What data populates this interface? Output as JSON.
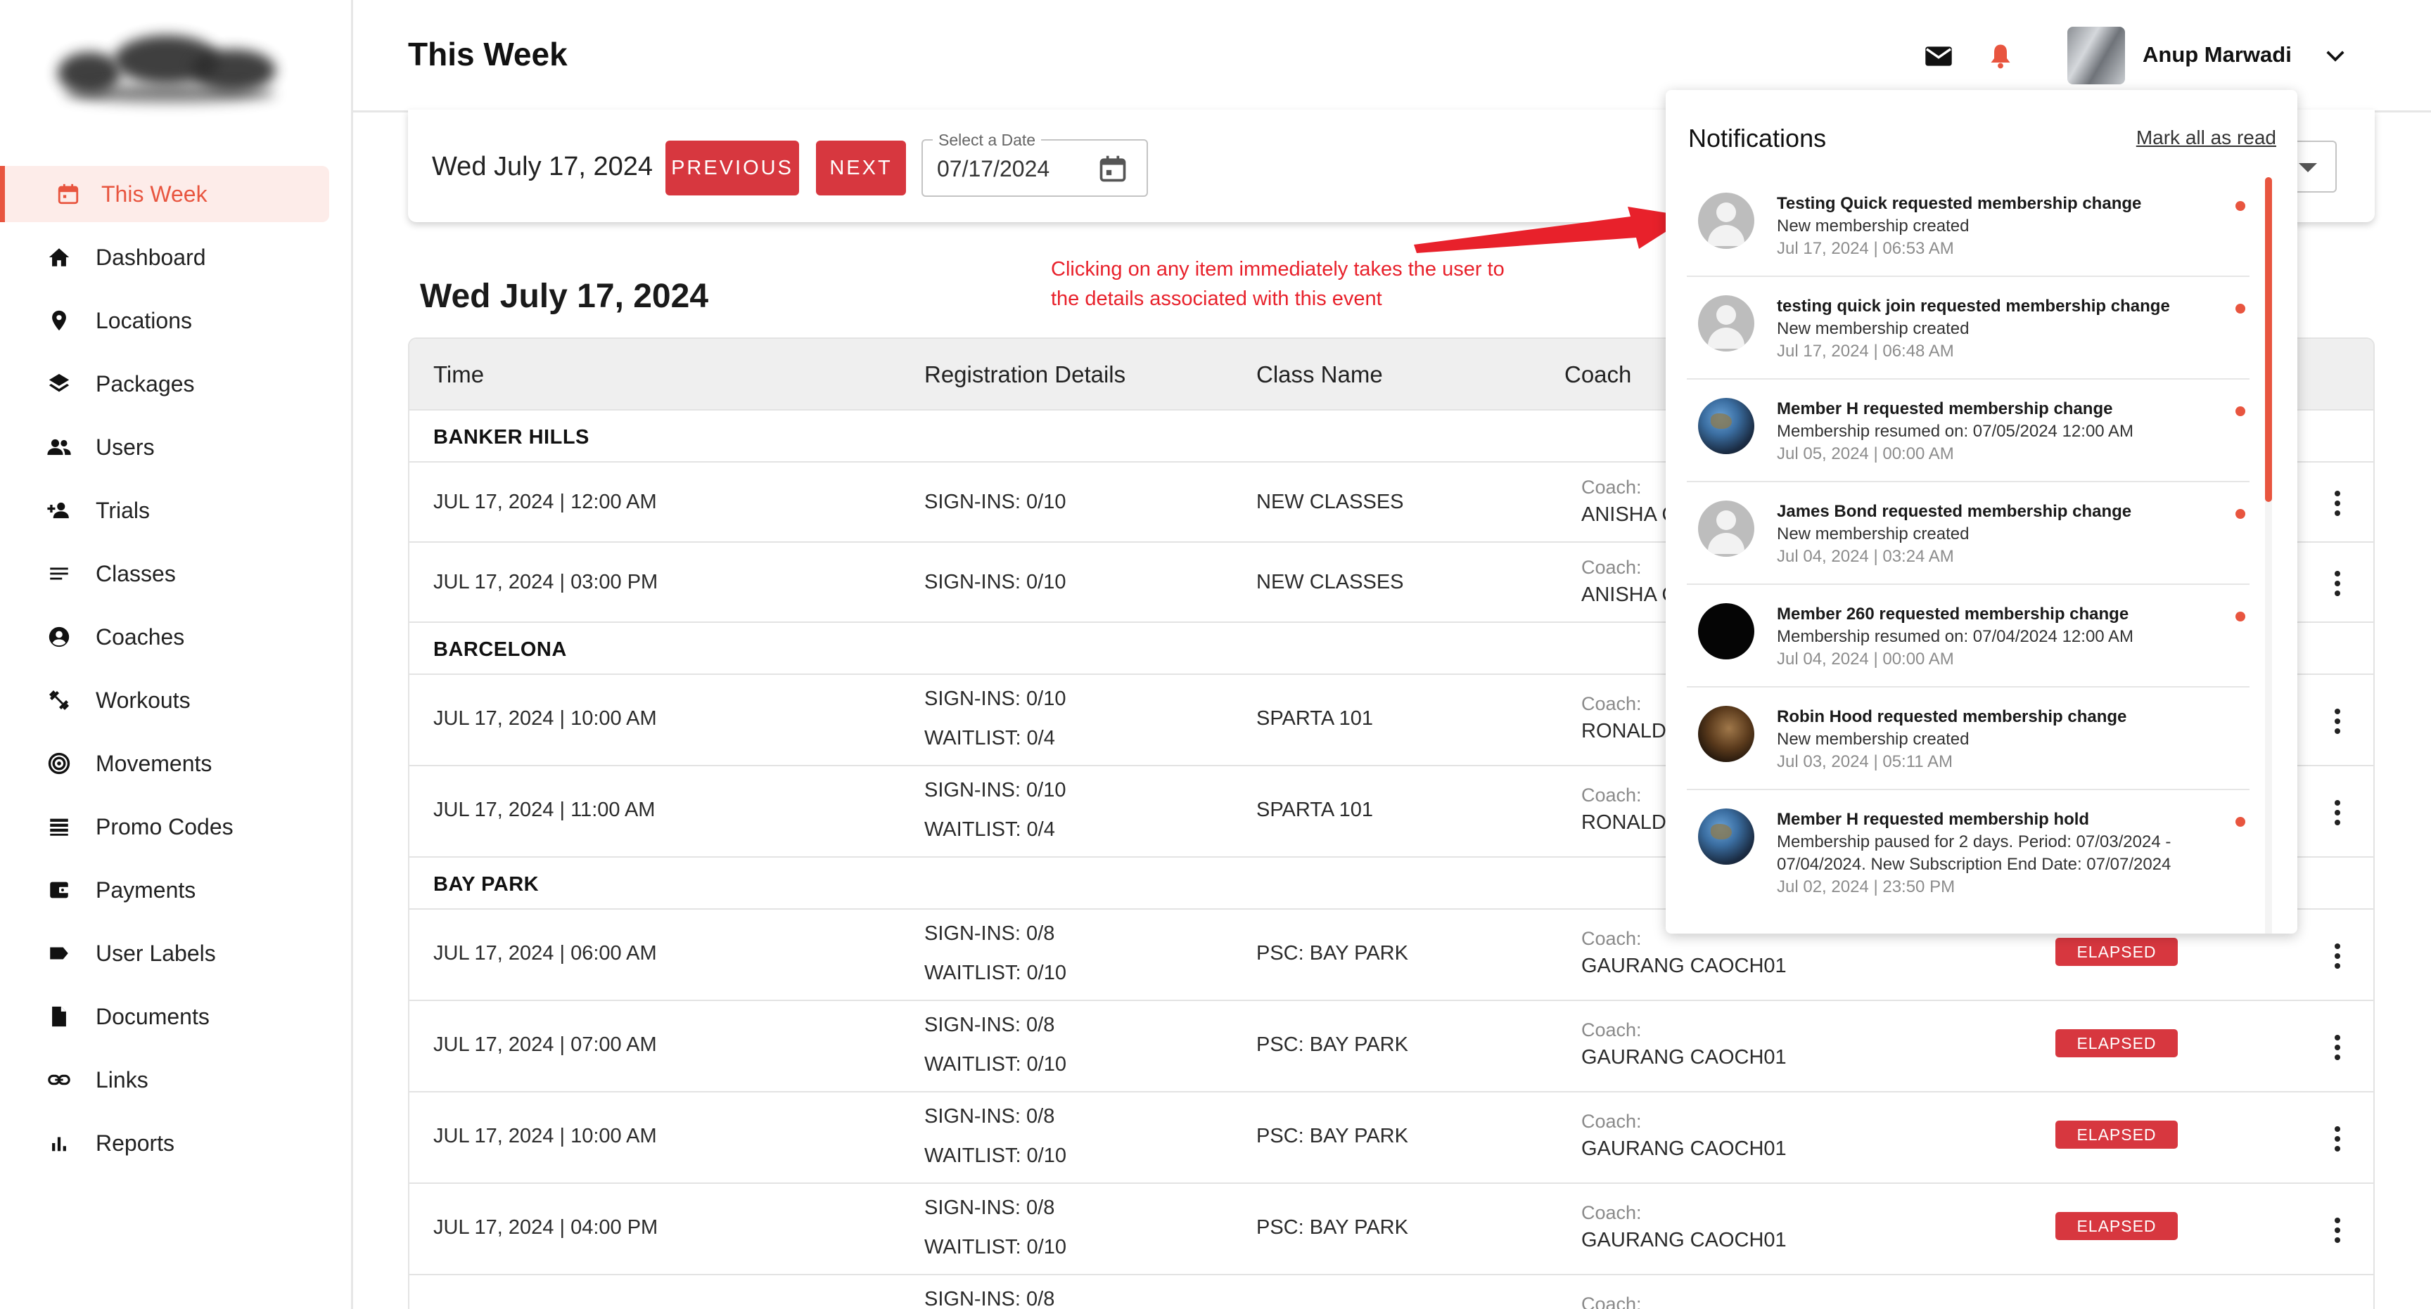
{
  "header": {
    "page_title": "This Week",
    "user_name": "Anup Marwadi"
  },
  "sidebar": {
    "items": [
      {
        "label": "This Week",
        "icon": "calendar-icon",
        "active": true
      },
      {
        "label": "Dashboard",
        "icon": "home-icon"
      },
      {
        "label": "Locations",
        "icon": "location-pin-icon"
      },
      {
        "label": "Packages",
        "icon": "layers-icon"
      },
      {
        "label": "Users",
        "icon": "users-icon"
      },
      {
        "label": "Trials",
        "icon": "person-add-icon"
      },
      {
        "label": "Classes",
        "icon": "list-lines-icon"
      },
      {
        "label": "Coaches",
        "icon": "account-circle-icon"
      },
      {
        "label": "Workouts",
        "icon": "dumbbell-icon"
      },
      {
        "label": "Movements",
        "icon": "target-icon"
      },
      {
        "label": "Promo Codes",
        "icon": "stack-lines-icon"
      },
      {
        "label": "Payments",
        "icon": "wallet-icon"
      },
      {
        "label": "User Labels",
        "icon": "label-tag-icon"
      },
      {
        "label": "Documents",
        "icon": "document-icon"
      },
      {
        "label": "Links",
        "icon": "link-icon"
      },
      {
        "label": "Reports",
        "icon": "bar-chart-icon"
      }
    ]
  },
  "datebar": {
    "current_date": "Wed July 17, 2024",
    "previous_label": "PREVIOUS",
    "next_label": "NEXT",
    "date_field_label": "Select a Date",
    "date_field_value": "07/17/2024"
  },
  "section_title": "Wed July 17, 2024",
  "annotation": {
    "line1": "Clicking on any item immediately takes the user to",
    "line2": "the details associated with this event"
  },
  "table": {
    "columns": [
      "Time",
      "Registration Details",
      "Class Name",
      "Coach"
    ],
    "coach_label": "Coach:",
    "status_label": "ELAPSED",
    "groups": [
      {
        "name": "BANKER HILLS",
        "rows": [
          {
            "time": "JUL 17, 2024 | 12:00 AM",
            "signins": "SIGN-INS: 0/10",
            "class": "NEW CLASSES",
            "coach": "ANISHA C"
          },
          {
            "time": "JUL 17, 2024 | 03:00 PM",
            "signins": "SIGN-INS: 0/10",
            "class": "NEW CLASSES",
            "coach": "ANISHA C"
          }
        ]
      },
      {
        "name": "BARCELONA",
        "rows": [
          {
            "time": "JUL 17, 2024 | 10:00 AM",
            "signins": "SIGN-INS: 0/10",
            "waitlist": "WAITLIST: 0/4",
            "class": "SPARTA 101",
            "coach": "RONALDO"
          },
          {
            "time": "JUL 17, 2024 | 11:00 AM",
            "signins": "SIGN-INS: 0/10",
            "waitlist": "WAITLIST: 0/4",
            "class": "SPARTA 101",
            "coach": "RONALDO"
          }
        ]
      },
      {
        "name": "BAY PARK",
        "rows": [
          {
            "time": "JUL 17, 2024 | 06:00 AM",
            "signins": "SIGN-INS: 0/8",
            "waitlist": "WAITLIST: 0/10",
            "class": "PSC: BAY PARK",
            "coach": "GAURANG CAOCH01"
          },
          {
            "time": "JUL 17, 2024 | 07:00 AM",
            "signins": "SIGN-INS: 0/8",
            "waitlist": "WAITLIST: 0/10",
            "class": "PSC: BAY PARK",
            "coach": "GAURANG CAOCH01"
          },
          {
            "time": "JUL 17, 2024 | 10:00 AM",
            "signins": "SIGN-INS: 0/8",
            "waitlist": "WAITLIST: 0/10",
            "class": "PSC: BAY PARK",
            "coach": "GAURANG CAOCH01"
          },
          {
            "time": "JUL 17, 2024 | 04:00 PM",
            "signins": "SIGN-INS: 0/8",
            "waitlist": "WAITLIST: 0/10",
            "class": "PSC: BAY PARK",
            "coach": "GAURANG CAOCH01"
          },
          {
            "signins": "SIGN-INS: 0/8",
            "coach_only_label": true
          }
        ]
      }
    ]
  },
  "notifications": {
    "title": "Notifications",
    "mark_all_label": "Mark all as read",
    "items": [
      {
        "avatar": "default",
        "head": "Testing Quick requested membership change",
        "body": "New membership created",
        "time": "Jul 17, 2024 | 06:53 AM"
      },
      {
        "avatar": "default",
        "head": "testing quick join requested membership change",
        "body": "New membership created",
        "time": "Jul 17, 2024 | 06:48 AM"
      },
      {
        "avatar": "earth",
        "head": "Member H requested membership change",
        "body": "Membership resumed on: 07/05/2024 12:00 AM",
        "time": "Jul 05, 2024 | 00:00 AM"
      },
      {
        "avatar": "default",
        "head": "James Bond requested membership change",
        "body": "New membership created",
        "time": "Jul 04, 2024 | 03:24 AM"
      },
      {
        "avatar": "black",
        "head": "Member 260 requested membership change",
        "body": "Membership resumed on: 07/04/2024 12:00 AM",
        "time": "Jul 04, 2024 | 00:00 AM"
      },
      {
        "avatar": "bronze",
        "head": "Robin Hood requested membership change",
        "body": "New membership created",
        "time": "Jul 03, 2024 | 05:11 AM"
      },
      {
        "avatar": "earth",
        "head": "Member H requested membership hold",
        "body": "Membership paused for 2 days. Period: 07/03/2024 - 07/04/2024. New Subscription End Date: 07/07/2024",
        "time": "Jul 02, 2024 | 23:50 PM"
      }
    ]
  },
  "colors": {
    "accent": "#e8553f",
    "button_red": "#d7373f",
    "annotation_red": "#e8212b"
  }
}
